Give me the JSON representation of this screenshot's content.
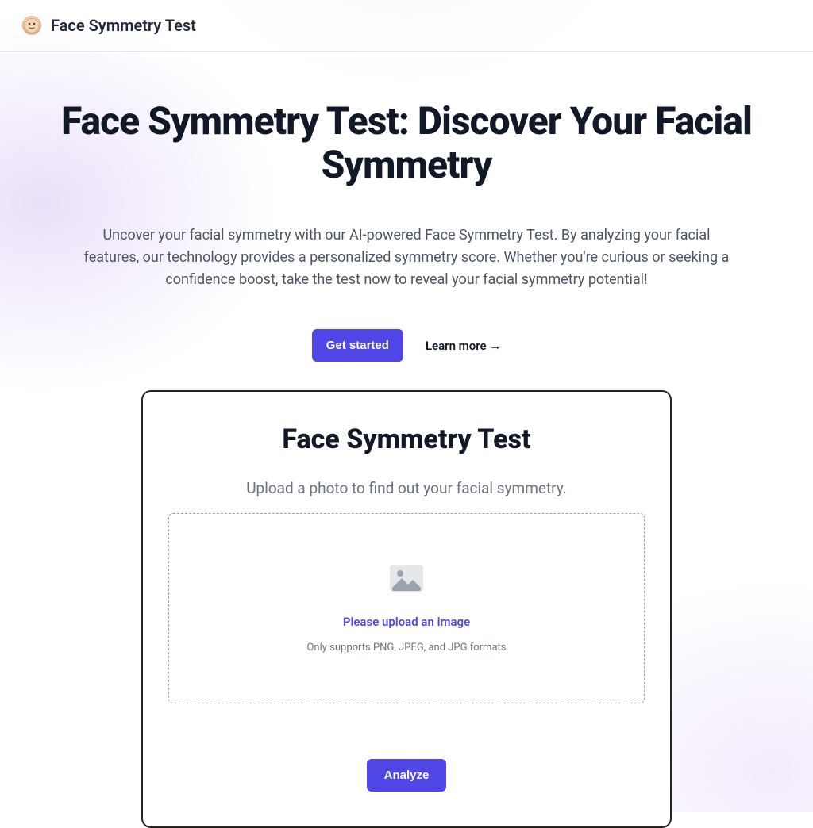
{
  "header": {
    "title": "Face Symmetry Test"
  },
  "hero": {
    "title": "Face Symmetry Test: Discover Your Facial Symmetry",
    "description": "Uncover your facial symmetry with our AI-powered Face Symmetry Test. By analyzing your facial features, our technology provides a personalized symmetry score. Whether you're curious or seeking a confidence boost, take the test now to reveal your facial symmetry potential!",
    "get_started_label": "Get started",
    "learn_more_label": "Learn more →"
  },
  "card": {
    "title": "Face Symmetry Test",
    "subtitle": "Upload a photo to find out your facial symmetry.",
    "upload_prompt": "Please upload an image",
    "upload_hint": "Only supports PNG, JPEG, and JPG formats",
    "analyze_label": "Analyze"
  }
}
